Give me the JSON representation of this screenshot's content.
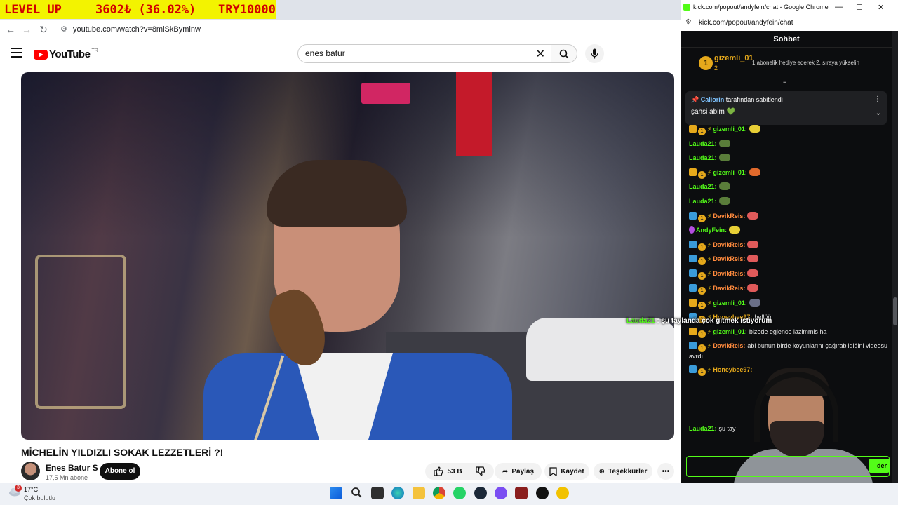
{
  "overlay": {
    "level_up": "LEVEL UP",
    "amount": "3602₺ (36.02%)",
    "goal": "TRY10000"
  },
  "browser": {
    "url": "youtube.com/watch?v=8mlSkByminw"
  },
  "youtube": {
    "logo_text": "YouTube",
    "logo_country": "TR",
    "search": {
      "value": "enes batur"
    },
    "video": {
      "title": "MİCHELİN YILDIZLI SOKAK LEZZETLERİ ?!",
      "channel": "Enes Batur S",
      "subscribers": "17,5 Mn abone",
      "subscribe_label": "Abone ol",
      "likes": "53 B",
      "share_label": "Paylaş",
      "save_label": "Kaydet",
      "thanks_label": "Teşekkürler",
      "more_label": "•••"
    }
  },
  "taskbar": {
    "temp": "17°C",
    "weather": "Çok bulutlu",
    "notification_count": "3"
  },
  "chat_window": {
    "title": "kick.com/popout/andyfein/chat - Google Chrome",
    "url": "kick.com/popout/andyfein/chat",
    "controls": {
      "minimize": "—",
      "maximize": "☐",
      "close": "✕"
    },
    "header": "Sohbet",
    "top_gifter": {
      "rank": "1",
      "name": "gizemli_01",
      "count": "2",
      "note": "1 abonelik hediye ederek 2. sıraya yükselin"
    },
    "pinned": {
      "by_user": "Caliorin",
      "by_suffix": "tarafından sabitlendi",
      "text": "şahsi abim 💚"
    },
    "messages": [
      {
        "user": "gizemli_01:",
        "text": "",
        "color": "#53fc18",
        "badges": "crown"
      },
      {
        "user": "Lauda21:",
        "text": "",
        "color": "#53fc18",
        "badges": ""
      },
      {
        "user": "Lauda21:",
        "text": "",
        "color": "#53fc18",
        "badges": ""
      },
      {
        "user": "gizemli_01:",
        "text": "",
        "color": "#53fc18",
        "badges": "crown"
      },
      {
        "user": "Lauda21:",
        "text": "",
        "color": "#53fc18",
        "badges": ""
      },
      {
        "user": "Lauda21:",
        "text": "",
        "color": "#53fc18",
        "badges": ""
      },
      {
        "user": "DavikReis:",
        "text": "",
        "color": "#ff8a3d",
        "badges": "og"
      },
      {
        "user": "AndyFein:",
        "text": "",
        "color": "#53fc18",
        "badges": "mic"
      },
      {
        "user": "DavikReis:",
        "text": "",
        "color": "#ff8a3d",
        "badges": "og"
      },
      {
        "user": "DavikReis:",
        "text": "",
        "color": "#ff8a3d",
        "badges": "og"
      },
      {
        "user": "DavikReis:",
        "text": "",
        "color": "#ff8a3d",
        "badges": "og"
      },
      {
        "user": "DavikReis:",
        "text": "",
        "color": "#ff8a3d",
        "badges": "og"
      },
      {
        "user": "gizemli_01:",
        "text": "",
        "color": "#53fc18",
        "badges": "crown"
      },
      {
        "user": "Honeybee97:",
        "text": "hellüü",
        "color": "#e6a91b",
        "badges": "og"
      },
      {
        "user": "gizemli_01:",
        "text": "bizede eglence lazimmis ha",
        "color": "#53fc18",
        "badges": "crown"
      },
      {
        "user": "DavikReis:",
        "text": "abi bunun birde koyunlarını çağırabildiğini videosu avrdı",
        "color": "#ff8a3d",
        "badges": "og"
      },
      {
        "user": "Honeybee97:",
        "text": "",
        "color": "#e6a91b",
        "badges": "og"
      },
      {
        "user": "Lauda21:",
        "text": "şu tay",
        "color": "#53fc18",
        "badges": ""
      }
    ],
    "floating": {
      "user": "Lauda21",
      "text": " : şu taylanda çok gitmek istiyorum"
    },
    "send_label": "der"
  }
}
